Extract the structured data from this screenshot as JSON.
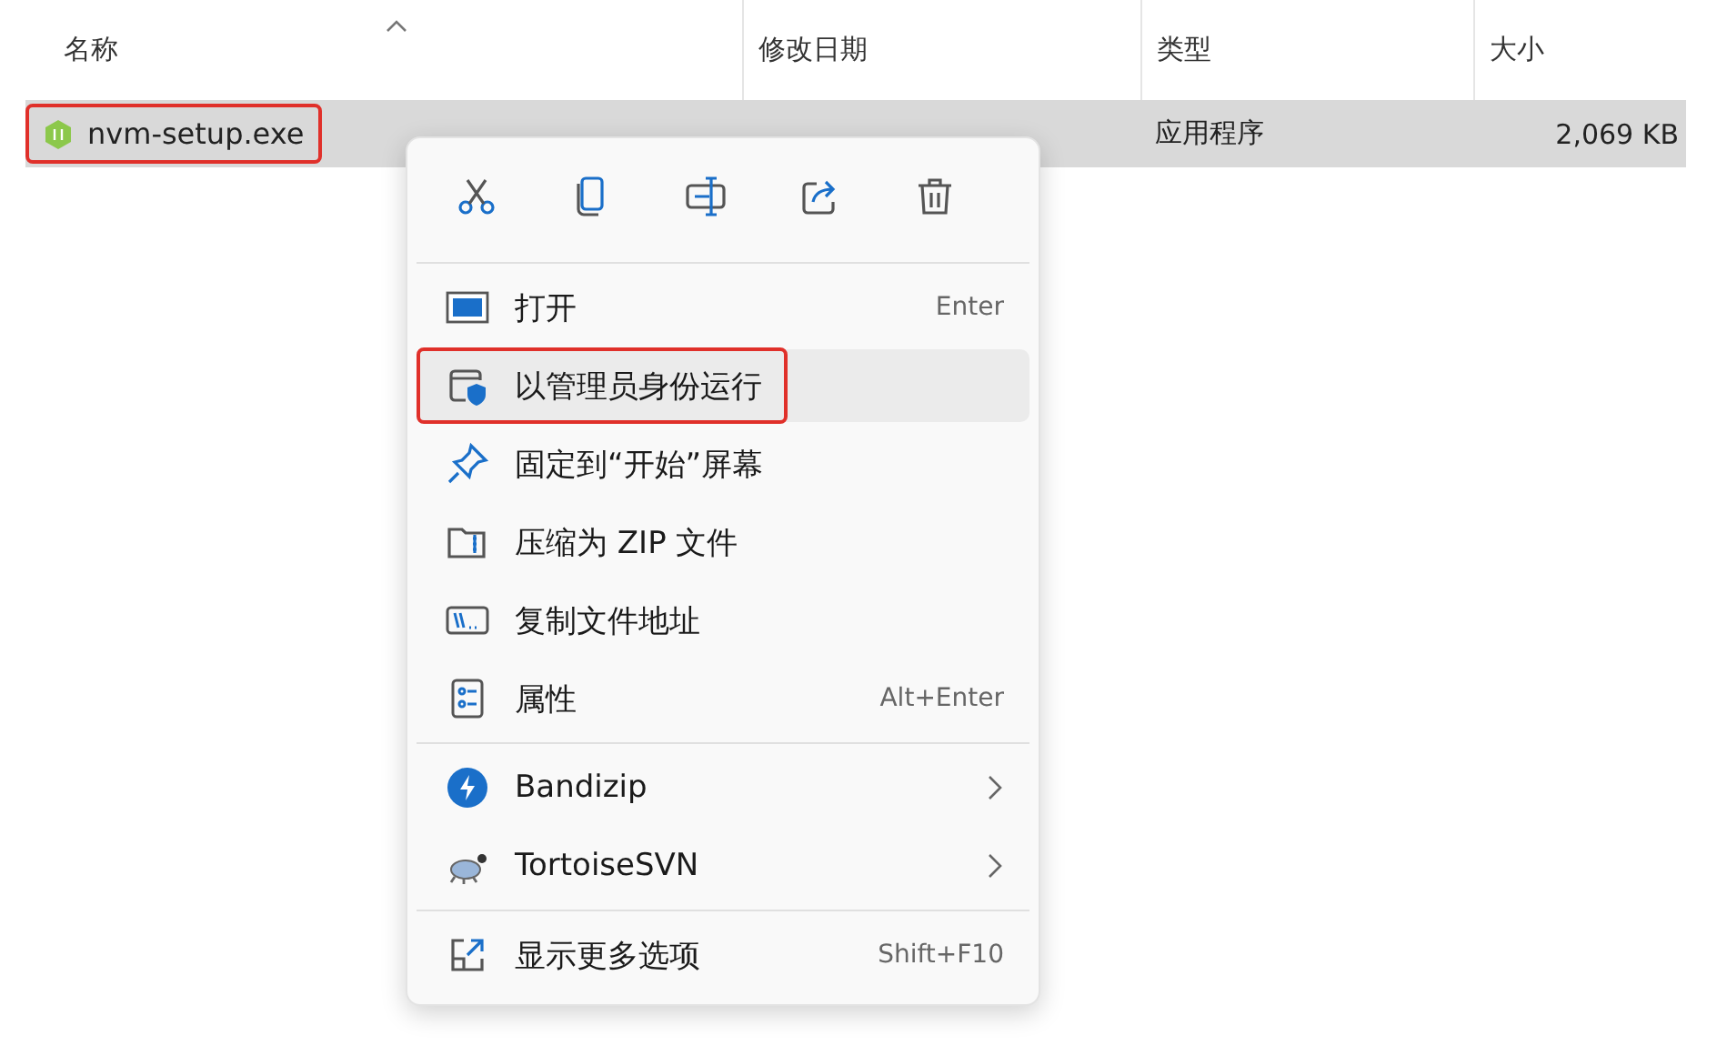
{
  "columns": [
    {
      "label": "名称",
      "sorted": true
    },
    {
      "label": "修改日期",
      "sorted": false
    },
    {
      "label": "类型",
      "sorted": false
    },
    {
      "label": "大小",
      "sorted": false
    }
  ],
  "files": [
    {
      "name": "nvm-setup.exe",
      "type": "应用程序",
      "size": "2,069 KB",
      "selected": true,
      "annotated": true
    }
  ],
  "context_menu": {
    "actions": [
      {
        "kind": "cut"
      },
      {
        "kind": "copy"
      },
      {
        "kind": "rename"
      },
      {
        "kind": "share"
      },
      {
        "kind": "delete"
      }
    ],
    "groups": [
      [
        {
          "kind": "open",
          "label": "打开",
          "shortcut": "Enter",
          "hovered": false,
          "annotated": false,
          "submenu": false
        },
        {
          "kind": "admin",
          "label": "以管理员身份运行",
          "hovered": true,
          "annotated": true,
          "submenu": false
        },
        {
          "kind": "pin",
          "label": "固定到“开始”屏幕",
          "hovered": false,
          "annotated": false,
          "submenu": false
        },
        {
          "kind": "zip",
          "label": "压缩为 ZIP 文件",
          "hovered": false,
          "annotated": false,
          "submenu": false
        },
        {
          "kind": "path",
          "label": "复制文件地址",
          "hovered": false,
          "annotated": false,
          "submenu": false
        },
        {
          "kind": "properties",
          "label": "属性",
          "shortcut": "Alt+Enter",
          "hovered": false,
          "annotated": false,
          "submenu": false
        }
      ],
      [
        {
          "kind": "bandizip",
          "label": "Bandizip",
          "hovered": false,
          "annotated": false,
          "submenu": true
        },
        {
          "kind": "turtle",
          "label": "TortoiseSVN",
          "hovered": false,
          "annotated": false,
          "submenu": true
        }
      ],
      [
        {
          "kind": "more",
          "label": "显示更多选项",
          "shortcut": "Shift+F10",
          "hovered": false,
          "annotated": false,
          "submenu": false
        }
      ]
    ]
  }
}
